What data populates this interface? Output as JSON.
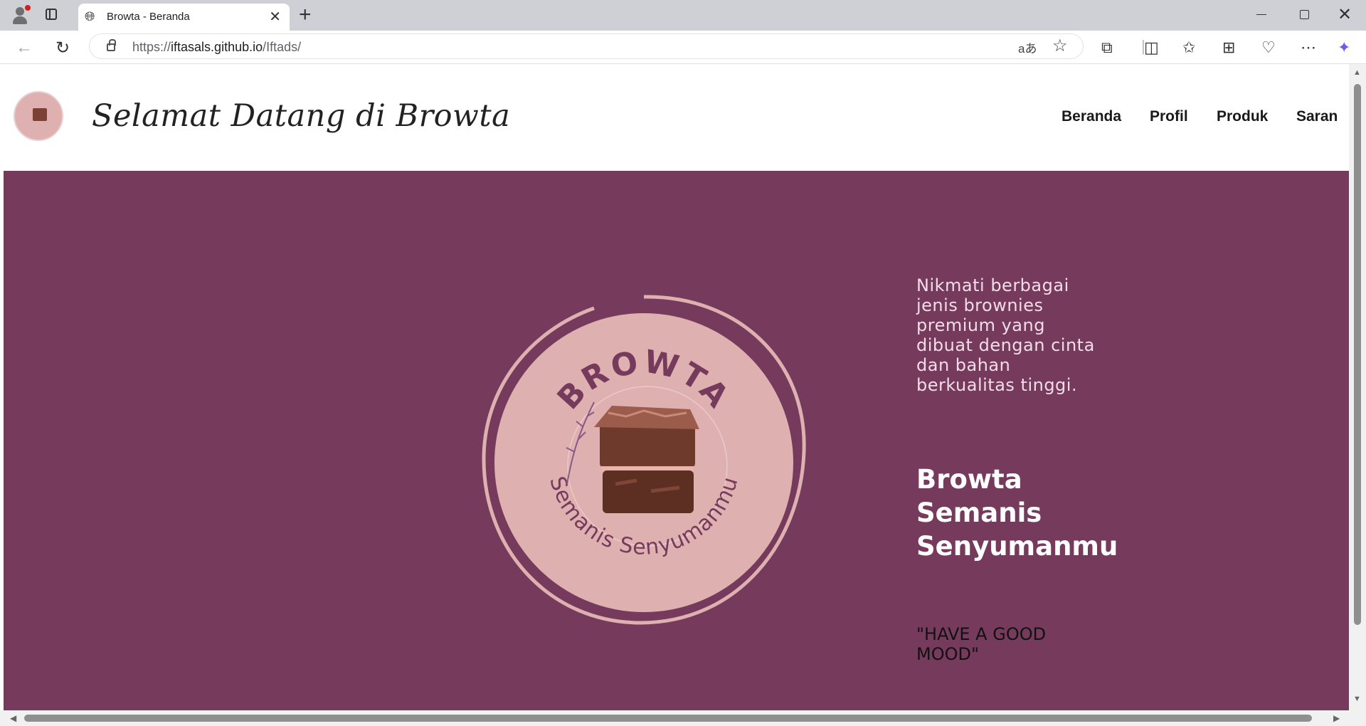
{
  "browser": {
    "tab_title": "Browta - Beranda",
    "url_prefix": "https://",
    "url_host": "iftasals.github.io",
    "url_path": "/Iftads/",
    "read_aloud_label": "aあ"
  },
  "header": {
    "title": "Selamat Datang di Browta",
    "nav": [
      "Beranda",
      "Profil",
      "Produk",
      "Saran"
    ]
  },
  "hero": {
    "logo_top_text": "BROWTA",
    "logo_bottom_text": "Semanis Senyumanmu",
    "description": "Nikmati berbagai jenis brownies premium yang dibuat dengan cinta dan bahan berkualitas tinggi.",
    "tagline": "Browta Semanis Senyumanmu",
    "mood": "\"HAVE A GOOD MOOD\""
  },
  "colors": {
    "hero_bg": "#763b5c",
    "logo_pink": "#deb0b0",
    "text_dark": "#1a1a1a"
  }
}
